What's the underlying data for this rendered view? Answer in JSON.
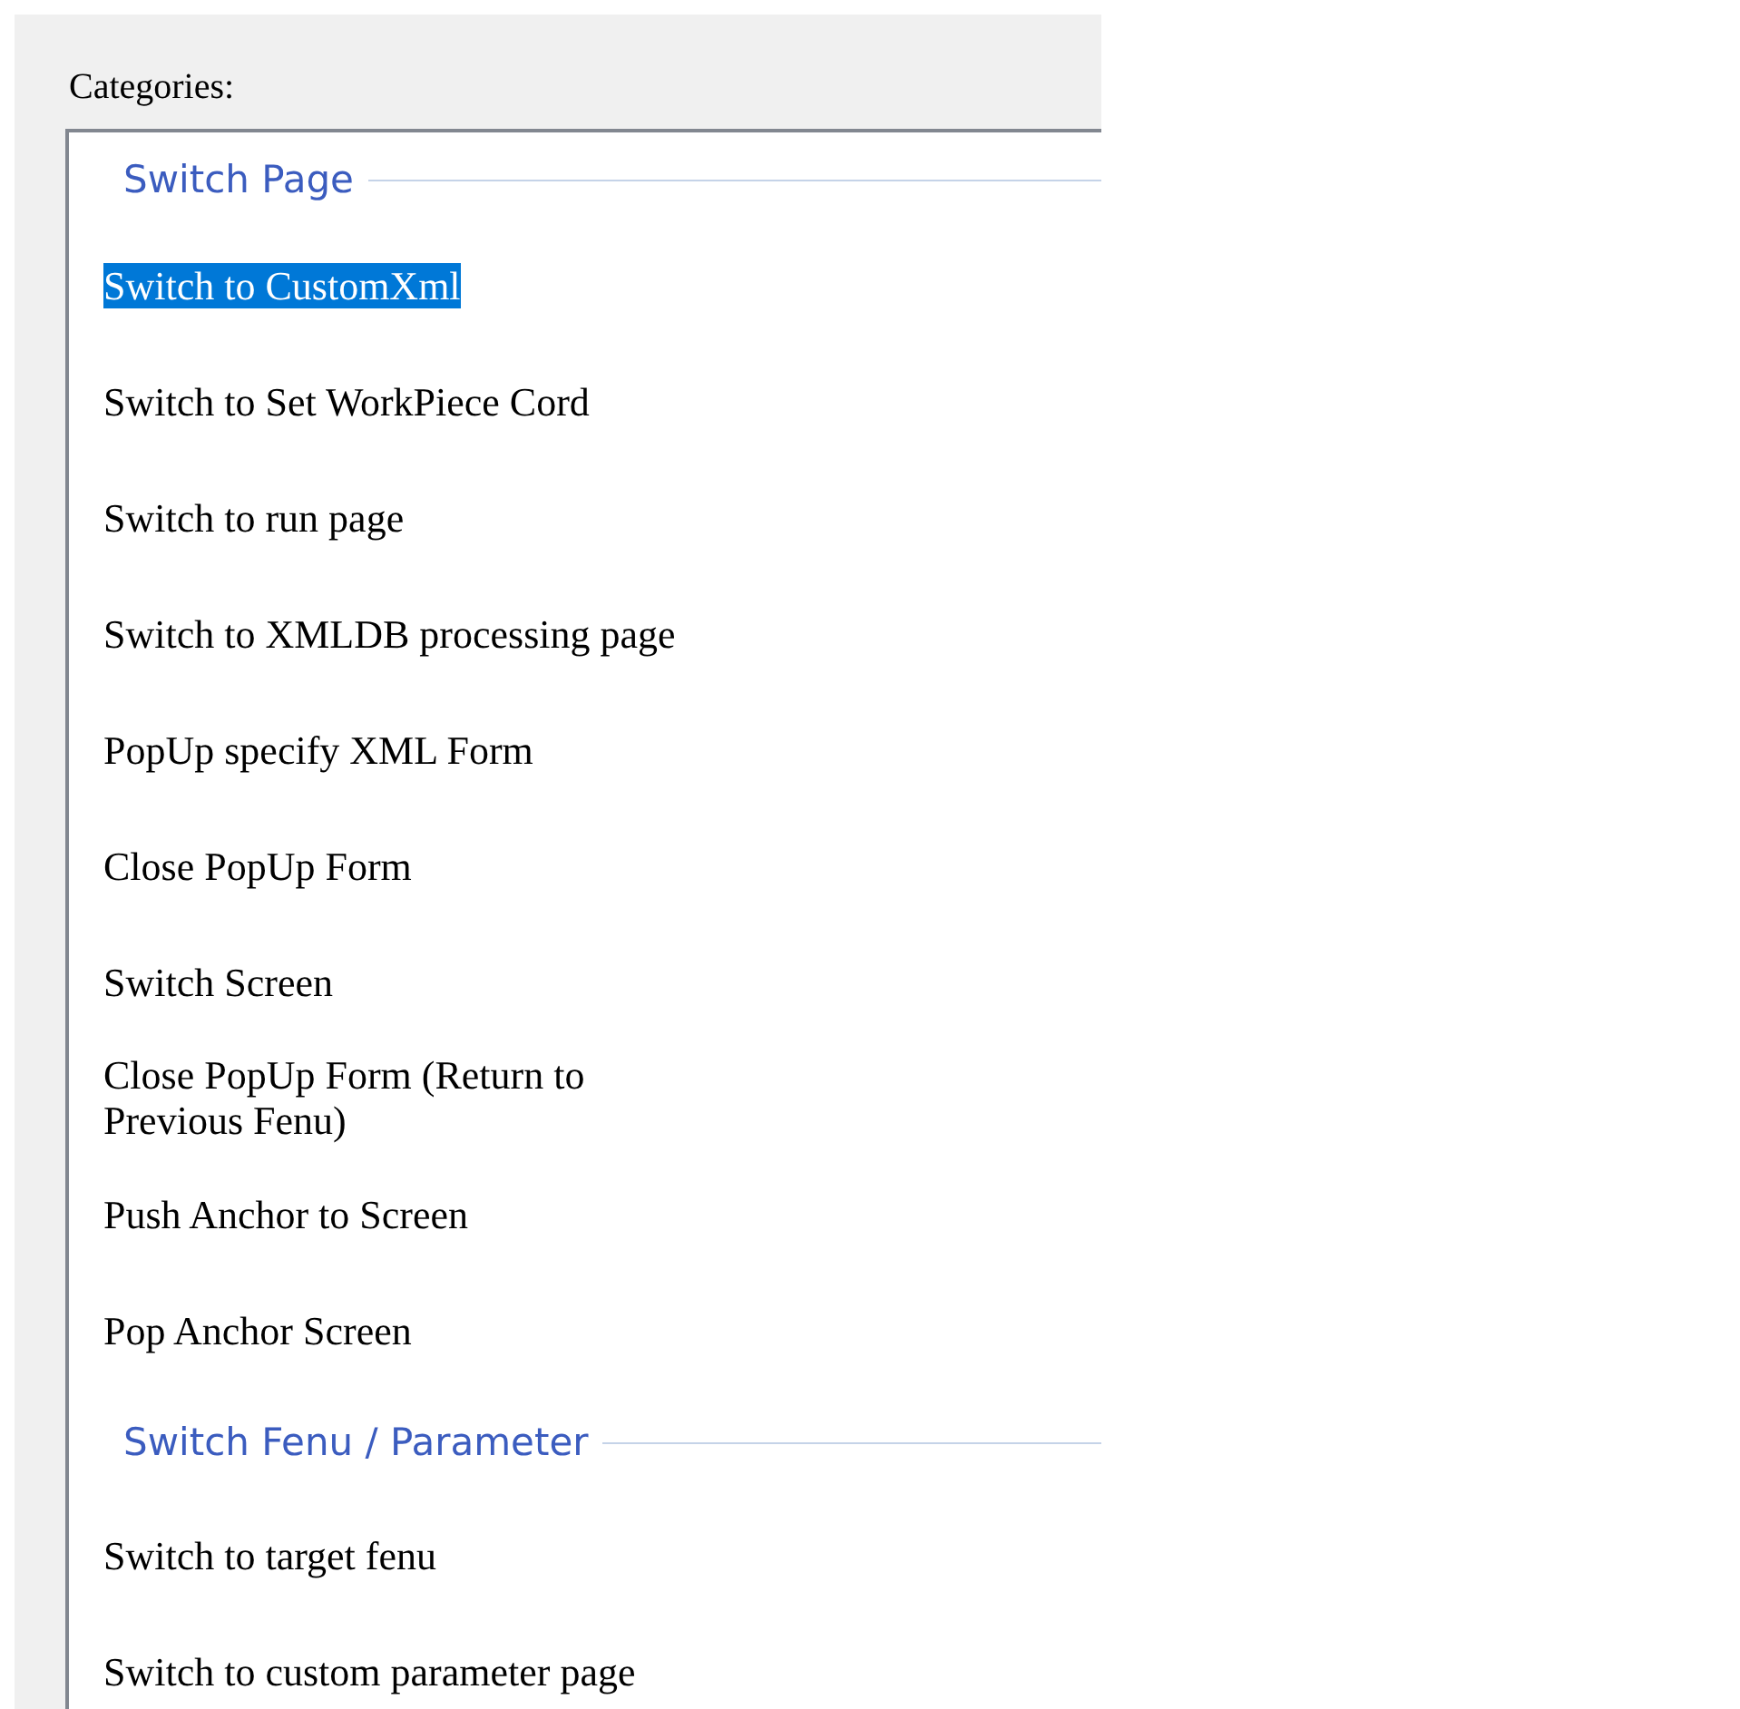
{
  "label": "Categories:",
  "groups": [
    {
      "title": "Switch Page",
      "items": [
        {
          "label": "Switch to CustomXml",
          "selected": true
        },
        {
          "label": "Switch to Set WorkPiece Cord",
          "selected": false
        },
        {
          "label": "Switch to run page",
          "selected": false
        },
        {
          "label": "Switch to XMLDB processing page",
          "selected": false
        },
        {
          "label": "PopUp specify XML Form",
          "selected": false
        },
        {
          "label": "Close PopUp Form",
          "selected": false
        },
        {
          "label": "Switch Screen",
          "selected": false
        },
        {
          "label": "Close PopUp Form (Return to Previous Fenu)",
          "selected": false
        },
        {
          "label": "Push Anchor to Screen",
          "selected": false
        },
        {
          "label": "Pop Anchor Screen",
          "selected": false
        }
      ]
    },
    {
      "title": "Switch Fenu / Parameter",
      "items": [
        {
          "label": "Switch to target fenu",
          "selected": false
        },
        {
          "label": "Switch to custom parameter page",
          "selected": false
        }
      ]
    }
  ]
}
